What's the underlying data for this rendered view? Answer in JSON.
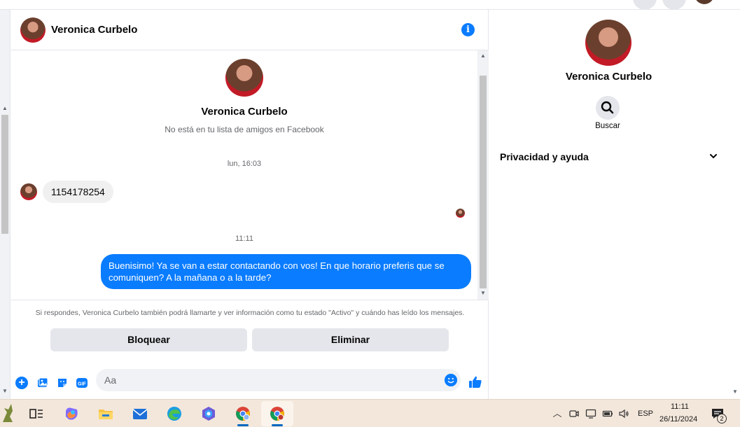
{
  "contact": {
    "name": "Veronica Curbelo",
    "not_friends": "No está en tu lista de amigos en Facebook"
  },
  "messages": {
    "timestamp1": "lun, 16:03",
    "incoming1": "1154178254",
    "timestamp2": "11:11",
    "outgoing1": "Buenisimo! Ya se van a estar contactando con vos! En que horario preferis que se comuniquen? A la mañana o a la tarde?"
  },
  "notice": {
    "text": "Si respondes, Veronica Curbelo también podrá llamarte y ver información como tu estado \"Activo\" y cuándo has leído los mensajes.",
    "block_label": "Bloquear",
    "delete_label": "Eliminar"
  },
  "composer": {
    "placeholder": "Aa",
    "gif_label": "GIF"
  },
  "right_panel": {
    "name": "Veronica Curbelo",
    "search_label": "Buscar",
    "privacy_label": "Privacidad y ayuda"
  },
  "taskbar": {
    "language": "ESP",
    "time": "11:11",
    "date": "26/11/2024",
    "notification_count": "2"
  },
  "colors": {
    "accent": "#0a7cff",
    "bubble_in": "#f0f0f0",
    "button_bg": "#e4e6eb"
  }
}
